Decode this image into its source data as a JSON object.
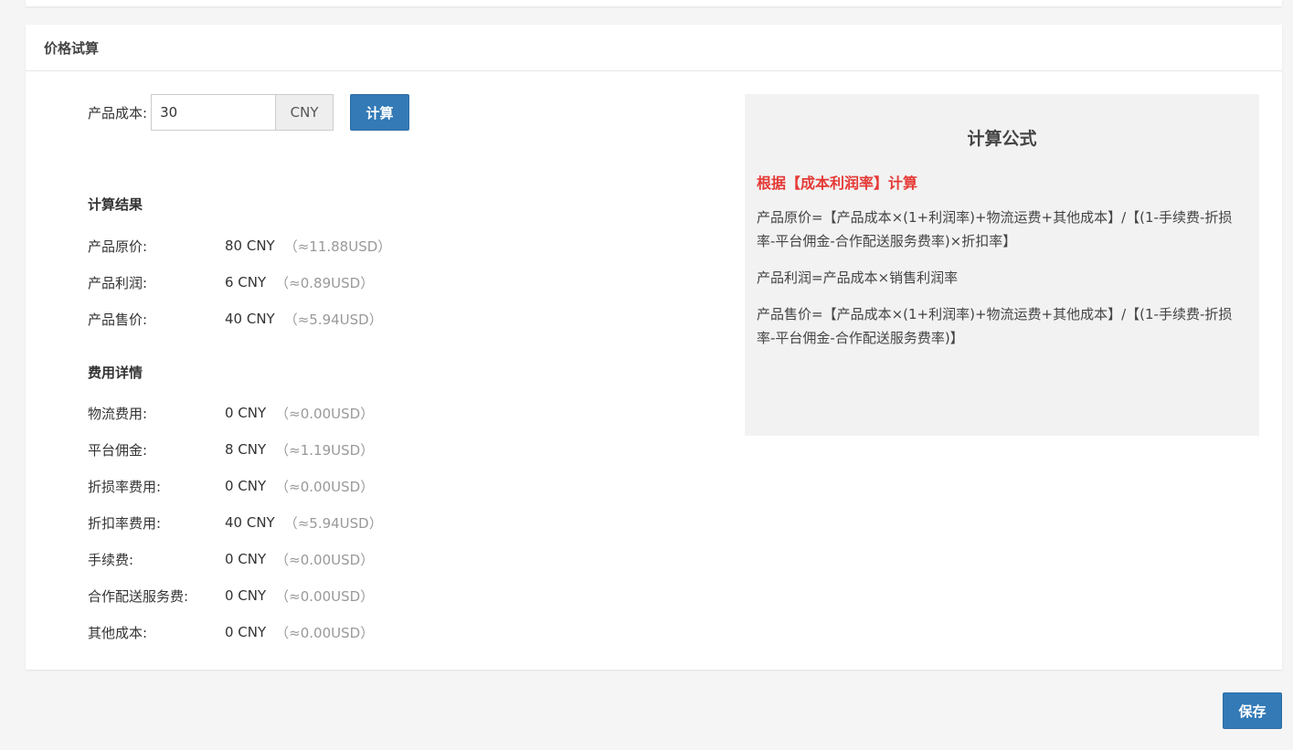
{
  "panel": {
    "title": "价格试算"
  },
  "cost_input": {
    "label": "产品成本:",
    "value": "30",
    "currency": "CNY",
    "calc_button": "计算"
  },
  "results": {
    "title": "计算结果",
    "items": [
      {
        "label": "产品原价:",
        "value": "80 CNY",
        "usd": "（≈11.88USD）"
      },
      {
        "label": "产品利润:",
        "value": "6 CNY",
        "usd": "（≈0.89USD）"
      },
      {
        "label": "产品售价:",
        "value": "40 CNY",
        "usd": "（≈5.94USD）"
      }
    ]
  },
  "fees": {
    "title": "费用详情",
    "items": [
      {
        "label": "物流费用:",
        "value": "0 CNY",
        "usd": "（≈0.00USD）"
      },
      {
        "label": "平台佣金:",
        "value": "8 CNY",
        "usd": "（≈1.19USD）"
      },
      {
        "label": "折损率费用:",
        "value": "0 CNY",
        "usd": "（≈0.00USD）"
      },
      {
        "label": "折扣率费用:",
        "value": "40 CNY",
        "usd": "（≈5.94USD）"
      },
      {
        "label": "手续费:",
        "value": "0 CNY",
        "usd": "（≈0.00USD）"
      },
      {
        "label": "合作配送服务费:",
        "value": "0 CNY",
        "usd": "（≈0.00USD）"
      },
      {
        "label": "其他成本:",
        "value": "0 CNY",
        "usd": "（≈0.00USD）"
      }
    ]
  },
  "formula": {
    "title": "计算公式",
    "subtitle": "根据【成本利润率】计算",
    "lines": [
      "产品原价=【产品成本×(1+利润率)+物流运费+其他成本】/【(1-手续费-折损率-平台佣金-合作配送服务费率)×折扣率】",
      "产品利润=产品成本×销售利润率",
      "产品售价=【产品成本×(1+利润率)+物流运费+其他成本】/【(1-手续费-折损率-平台佣金-合作配送服务费率)】"
    ]
  },
  "save_button": "保存",
  "colors": {
    "primary": "#337ab7",
    "highlight_red": "#e53935",
    "muted_usd": "#999999",
    "formula_bg": "#f2f2f2"
  }
}
